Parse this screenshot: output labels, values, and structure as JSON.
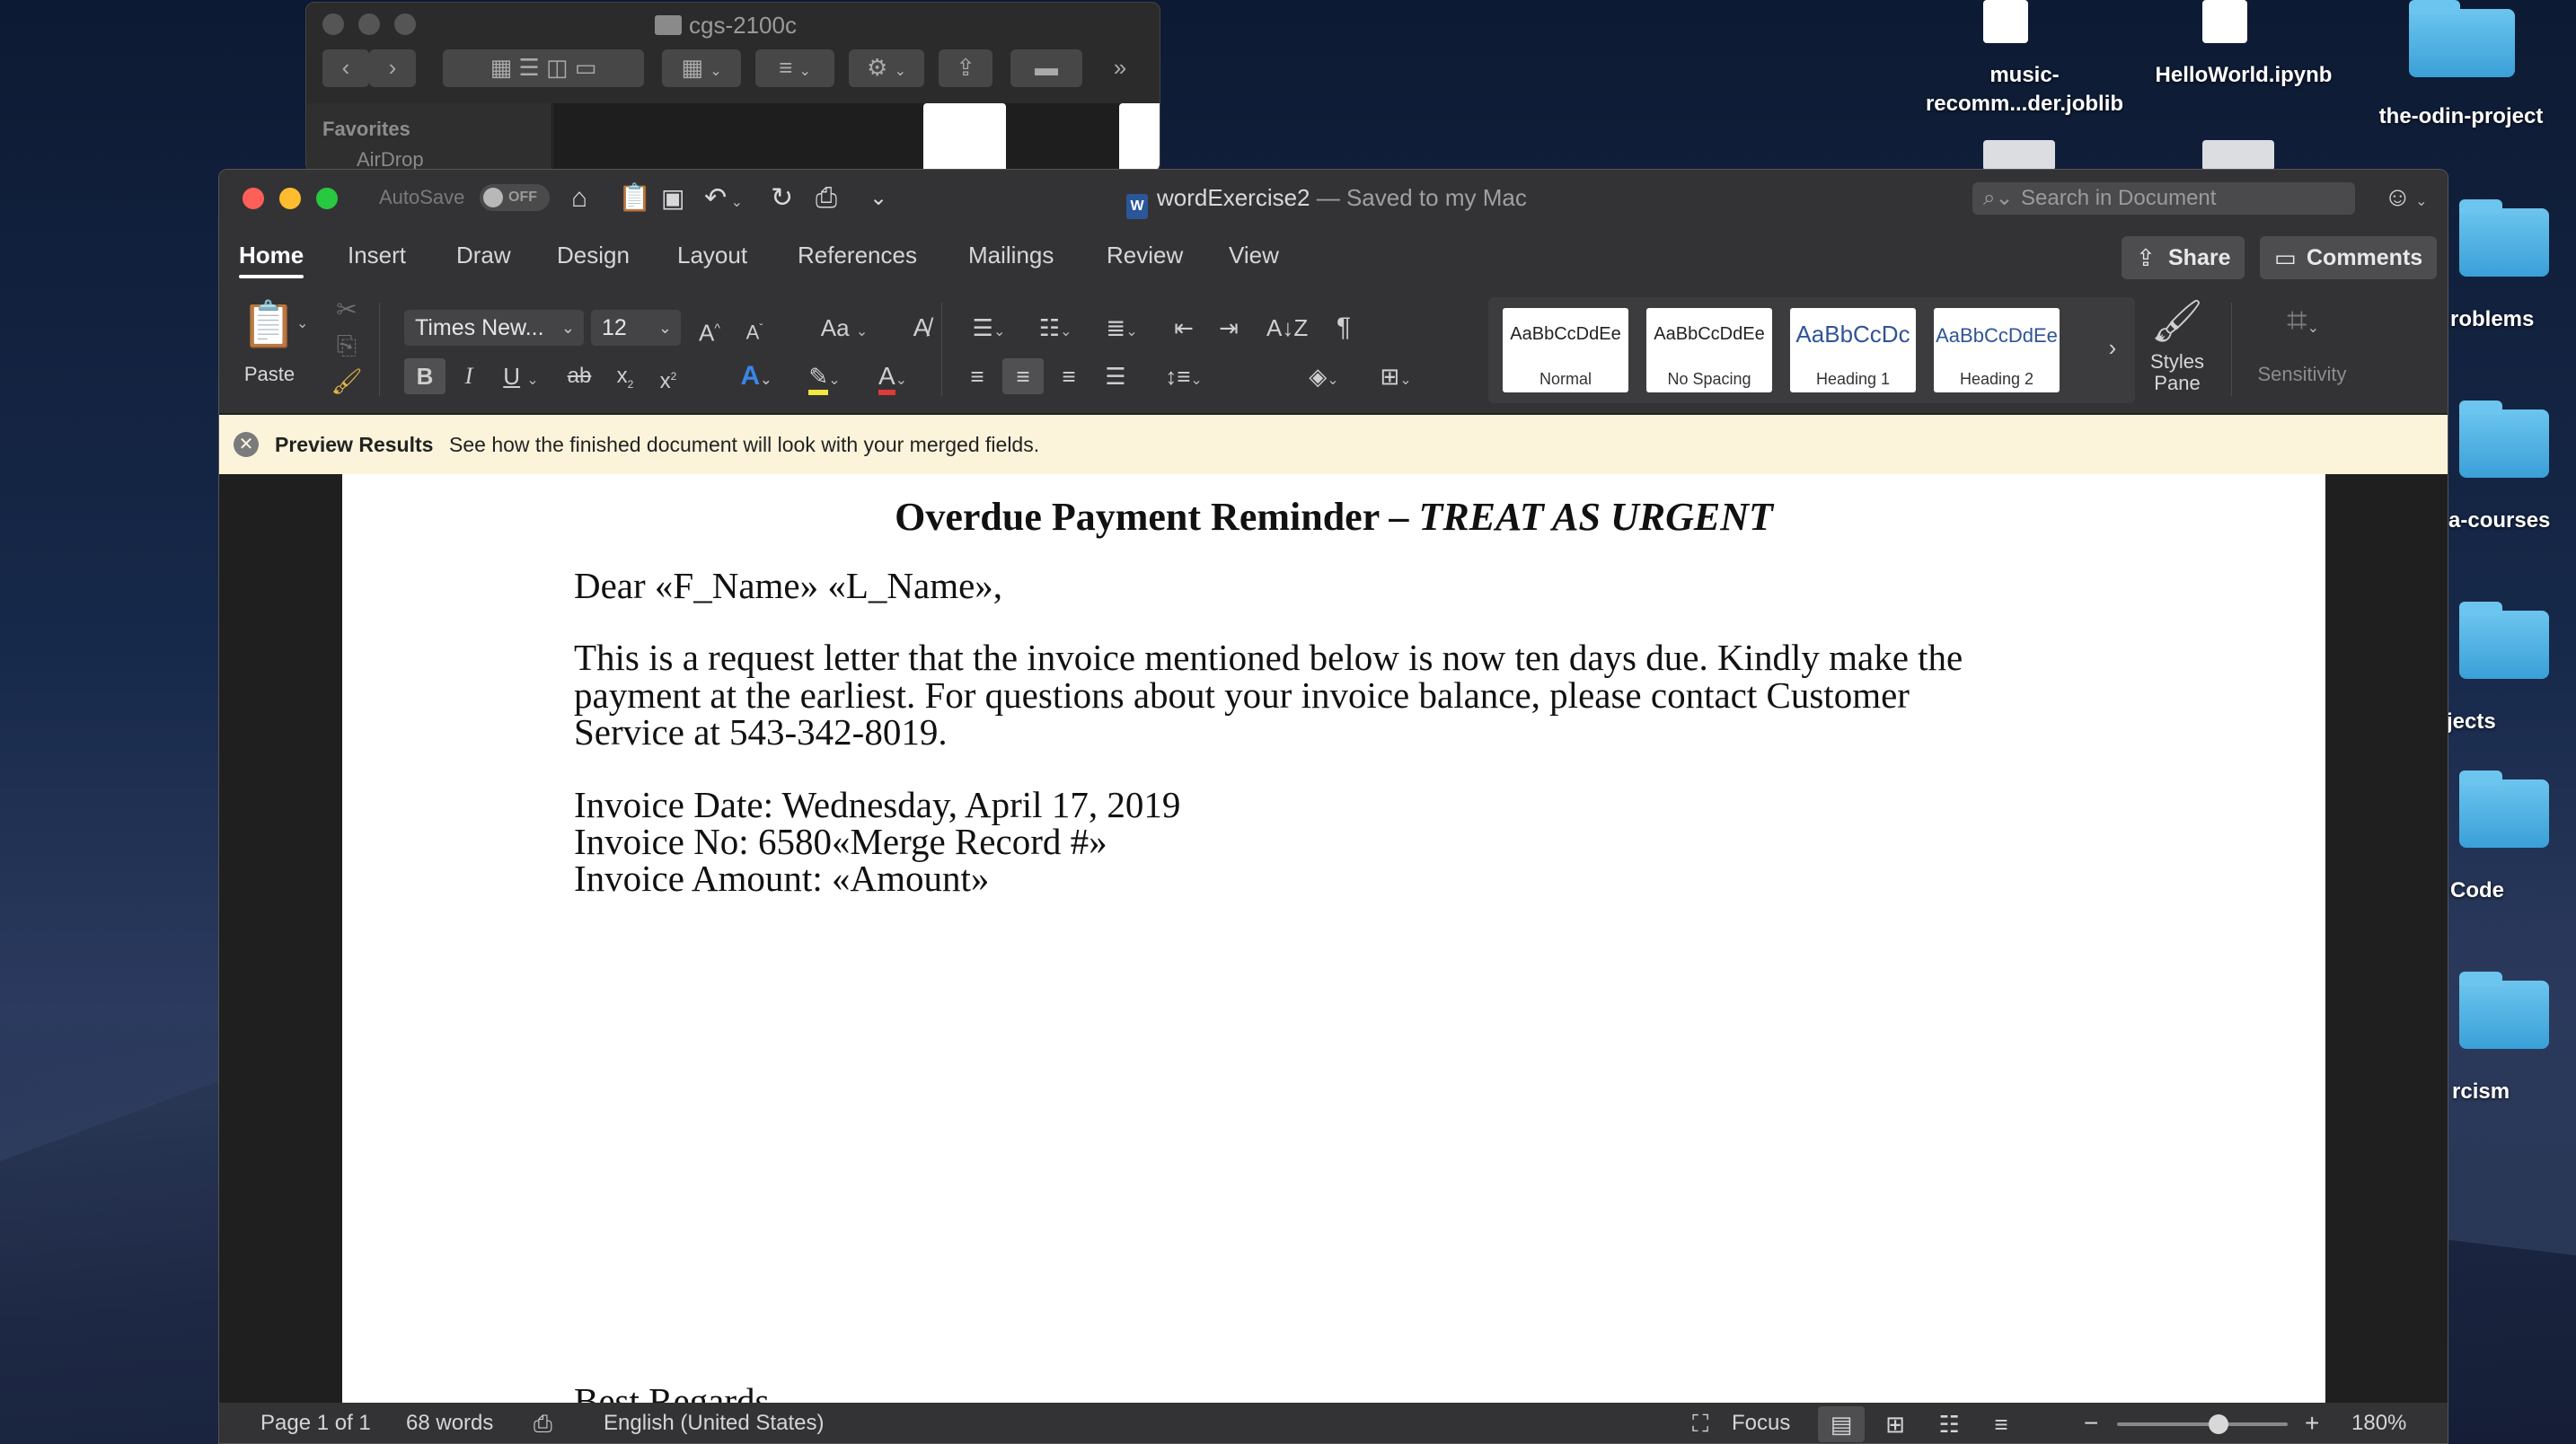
{
  "desktop": {
    "icons": [
      {
        "label_line1": "music-",
        "label_line2": "recomm...der.joblib"
      },
      {
        "label_line1": "HelloWorld.ipynb",
        "label_line2": ""
      },
      {
        "label_line1": "the-odin-project",
        "label_line2": ""
      }
    ],
    "side_labels": [
      "roblems",
      "a-courses",
      "jects",
      "Code",
      "rcism"
    ]
  },
  "finder": {
    "title": "cgs-2100c",
    "sidebar_heading": "Favorites",
    "sidebar_item": "AirDrop"
  },
  "word": {
    "autosave_label": "AutoSave",
    "toggle_state": "OFF",
    "doc_name": "wordExercise2",
    "saved_status": " — Saved to my Mac",
    "search_placeholder": "Search in Document",
    "tabs": [
      "Home",
      "Insert",
      "Draw",
      "Design",
      "Layout",
      "References",
      "Mailings",
      "Review",
      "View"
    ],
    "share_label": "Share",
    "comments_label": "Comments",
    "ribbon": {
      "paste_label": "Paste",
      "font_name": "Times New...",
      "font_size": "12",
      "styles": [
        {
          "sample": "AaBbCcDdEe",
          "name": "Normal"
        },
        {
          "sample": "AaBbCcDdEe",
          "name": "No Spacing"
        },
        {
          "sample": "AaBbCcDc",
          "name": "Heading 1"
        },
        {
          "sample": "AaBbCcDdEe",
          "name": "Heading 2"
        }
      ],
      "styles_pane_label_1": "Styles",
      "styles_pane_label_2": "Pane",
      "sensitivity_label": "Sensitivity"
    },
    "message_bar": {
      "title": "Preview Results",
      "message": "See how the finished document will look with your merged fields."
    },
    "document": {
      "heading_normal": "Overdue Payment Reminder – ",
      "heading_italic": "TREAT AS URGENT",
      "salutation": "Dear «F_Name» «L_Name»,",
      "para_line1": "This is a request letter that the invoice mentioned below is now ten days due. Kindly make the",
      "para_line2": "payment at the earliest. For questions about your invoice balance, please contact Customer",
      "para_line3": "Service at 543-342-8019.",
      "invoice_date": "Invoice Date: Wednesday, April 17, 2019",
      "invoice_no": "Invoice No: 6580«Merge Record #»",
      "invoice_amount": "Invoice Amount: «Amount»",
      "closing_partial": "Best Regards,"
    },
    "status": {
      "page": "Page 1 of 1",
      "words": "68 words",
      "language": "English (United States)",
      "focus": "Focus",
      "zoom": "180%",
      "zoom_fraction": 0.55
    }
  },
  "colors": {
    "accent": "#2b579a",
    "red_light": "#fe5f57",
    "yellow_light": "#febc2e",
    "green_light": "#28c840",
    "highlight_yellow": "#f5e642",
    "font_red": "#e03a3a"
  }
}
